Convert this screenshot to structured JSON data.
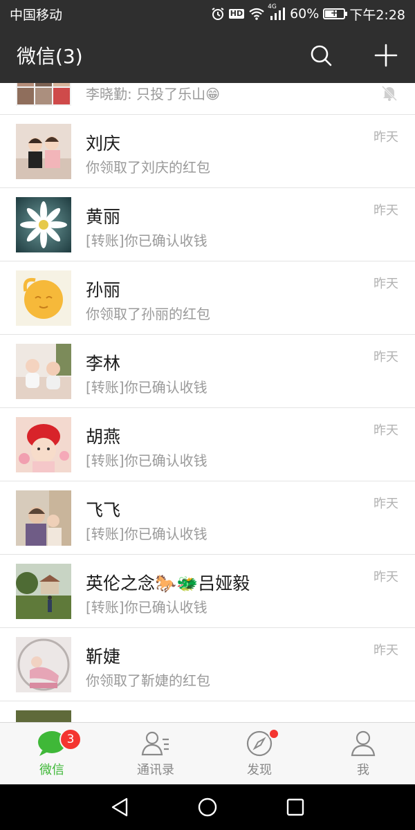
{
  "status_bar": {
    "carrier": "中国移动",
    "hd": "HD",
    "network": "4G",
    "battery_percent": "60%",
    "time": "下午2:28"
  },
  "header": {
    "title": "微信(3)",
    "search_icon": "search-icon",
    "add_icon": "plus-icon"
  },
  "chats": [
    {
      "name": "",
      "preview": "李晓勤: 只投了乐山😁",
      "time": "",
      "muted": true
    },
    {
      "name": "刘庆",
      "preview": "你领取了刘庆的红包",
      "time": "昨天"
    },
    {
      "name": "黄丽",
      "preview": "[转账]你已确认收钱",
      "time": "昨天"
    },
    {
      "name": "孙丽",
      "preview": "你领取了孙丽的红包",
      "time": "昨天"
    },
    {
      "name": "李林",
      "preview": "[转账]你已确认收钱",
      "time": "昨天"
    },
    {
      "name": "胡燕",
      "preview": "[转账]你已确认收钱",
      "time": "昨天"
    },
    {
      "name": "飞飞",
      "preview": "[转账]你已确认收钱",
      "time": "昨天"
    },
    {
      "name": "英伦之念🐎🐲吕娅毅",
      "preview": "[转账]你已确认收钱",
      "time": "昨天"
    },
    {
      "name": "靳婕",
      "preview": "你领取了靳婕的红包",
      "time": "昨天"
    }
  ],
  "tabs": [
    {
      "label": "微信",
      "icon": "chat-bubble-icon",
      "badge": "3",
      "active": true
    },
    {
      "label": "通讯录",
      "icon": "contacts-icon"
    },
    {
      "label": "发现",
      "icon": "compass-icon",
      "dot": true
    },
    {
      "label": "我",
      "icon": "person-icon"
    }
  ],
  "colors": {
    "header_bg": "#2f2f2f",
    "accent_green": "#3fb838",
    "badge_red": "#f43530",
    "muted_text": "#9a9a9a"
  }
}
